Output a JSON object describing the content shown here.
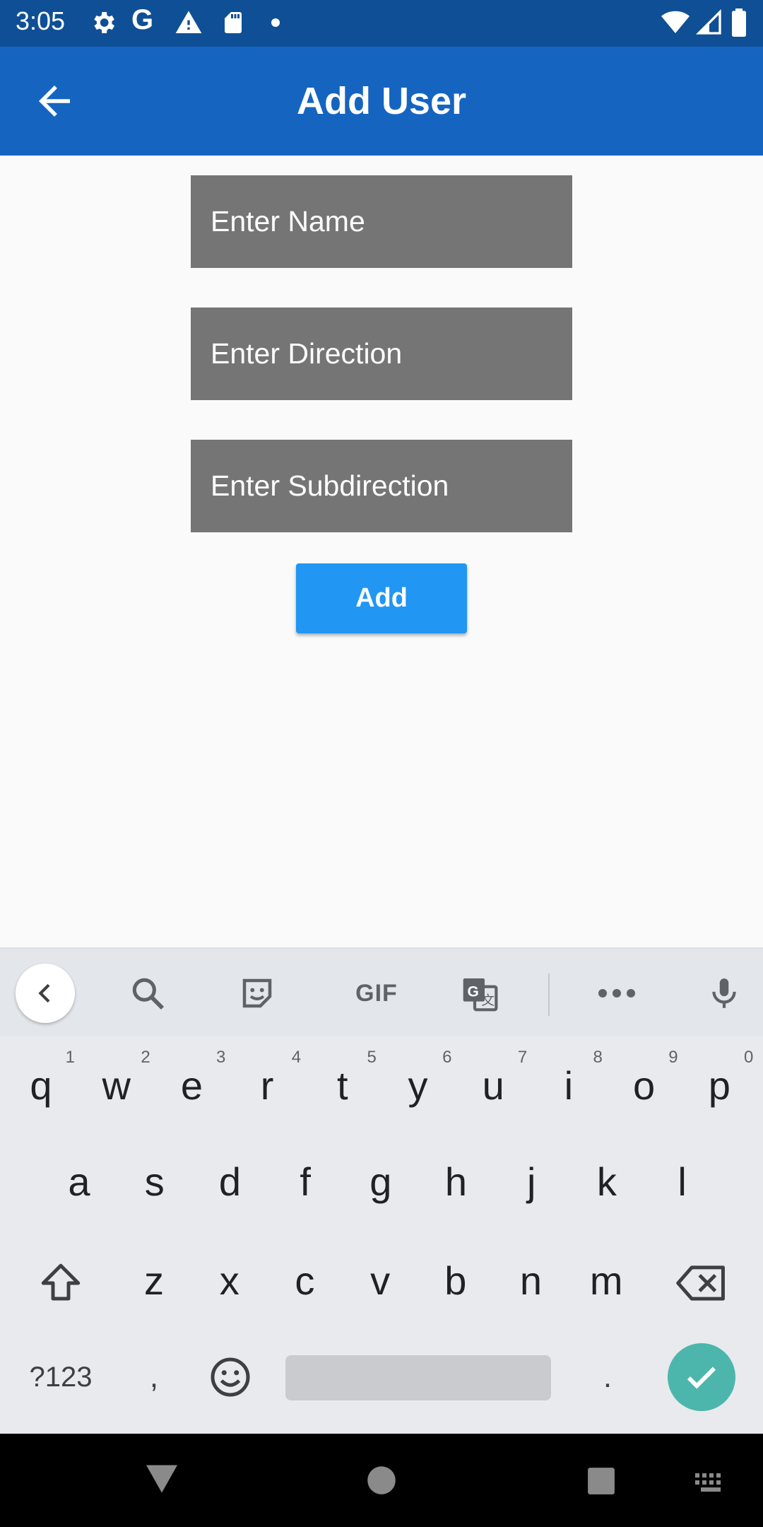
{
  "status_bar": {
    "time": "3:05",
    "left_icons": [
      "settings-icon",
      "google-icon",
      "alert-icon",
      "sd-card-icon",
      "dot-icon"
    ],
    "right_icons": [
      "wifi-icon",
      "signal-icon",
      "battery-icon"
    ]
  },
  "app_bar": {
    "title": "Add User",
    "color": "#1565c0"
  },
  "form": {
    "name_placeholder": "Enter Name",
    "direction_placeholder": "Enter Direction",
    "subdirection_placeholder": "Enter Subdirection",
    "add_label": "Add",
    "field_color": "#757575",
    "button_color": "#2196f3"
  },
  "keyboard": {
    "toolbar": {
      "gif_label": "GIF",
      "icons": [
        "chevron-left-icon",
        "search-icon",
        "sticker-icon",
        "gif-icon",
        "translate-icon",
        "more-icon",
        "mic-icon"
      ]
    },
    "row1": [
      {
        "key": "q",
        "hint": "1"
      },
      {
        "key": "w",
        "hint": "2"
      },
      {
        "key": "e",
        "hint": "3"
      },
      {
        "key": "r",
        "hint": "4"
      },
      {
        "key": "t",
        "hint": "5"
      },
      {
        "key": "y",
        "hint": "6"
      },
      {
        "key": "u",
        "hint": "7"
      },
      {
        "key": "i",
        "hint": "8"
      },
      {
        "key": "o",
        "hint": "9"
      },
      {
        "key": "p",
        "hint": "0"
      }
    ],
    "row2": [
      "a",
      "s",
      "d",
      "f",
      "g",
      "h",
      "j",
      "k",
      "l"
    ],
    "row3": [
      "z",
      "x",
      "c",
      "v",
      "b",
      "n",
      "m"
    ],
    "symbols_label": "?123",
    "comma_label": ",",
    "period_label": ".",
    "enter_color": "#4db6ac"
  },
  "nav_bar": {
    "icons": [
      "back-triangle-icon",
      "home-circle-icon",
      "recents-square-icon",
      "keyboard-icon"
    ]
  }
}
